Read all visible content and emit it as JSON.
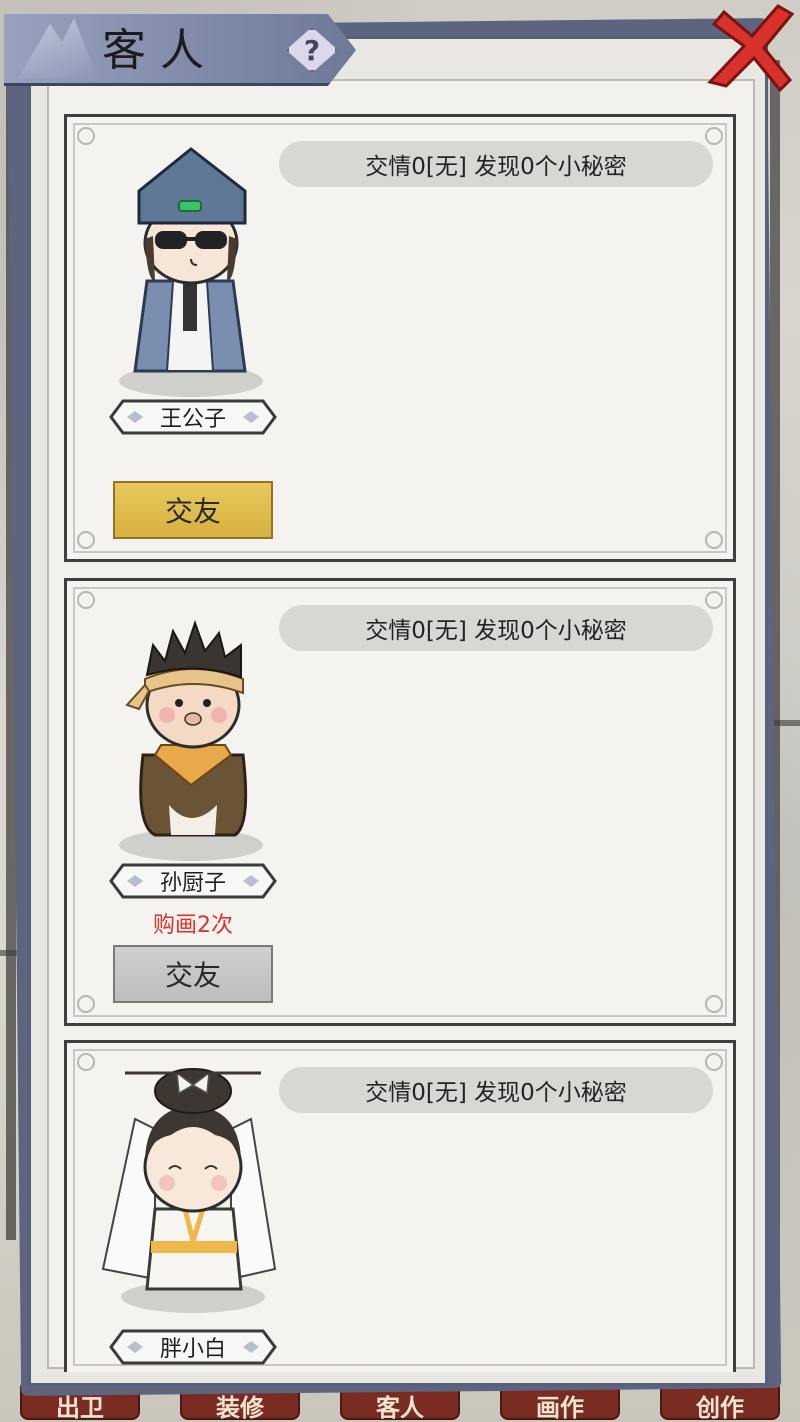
{
  "header": {
    "title": "客人",
    "help_icon": "question-mark-icon",
    "close_icon": "close-x-icon"
  },
  "colors": {
    "panel_border": "#56607a",
    "gold_button": "#e2c04f",
    "grey_button": "#c6c6c6",
    "purchase_note": "#e0302a",
    "close_red": "#d9322c"
  },
  "guests": [
    {
      "name": "王公子",
      "info": "交情0[无] 发现0个小秘密",
      "purchase_note": "",
      "button_label": "交友",
      "button_state": "active"
    },
    {
      "name": "孙厨子",
      "info": "交情0[无] 发现0个小秘密",
      "purchase_note": "购画2次",
      "button_label": "交友",
      "button_state": "disabled"
    },
    {
      "name": "胖小白",
      "info": "交情0[无] 发现0个小秘密",
      "purchase_note": "",
      "button_label": "",
      "button_state": ""
    }
  ],
  "bottom_tabs": [
    "出卫",
    "装修",
    "客人",
    "画作",
    "创作"
  ]
}
